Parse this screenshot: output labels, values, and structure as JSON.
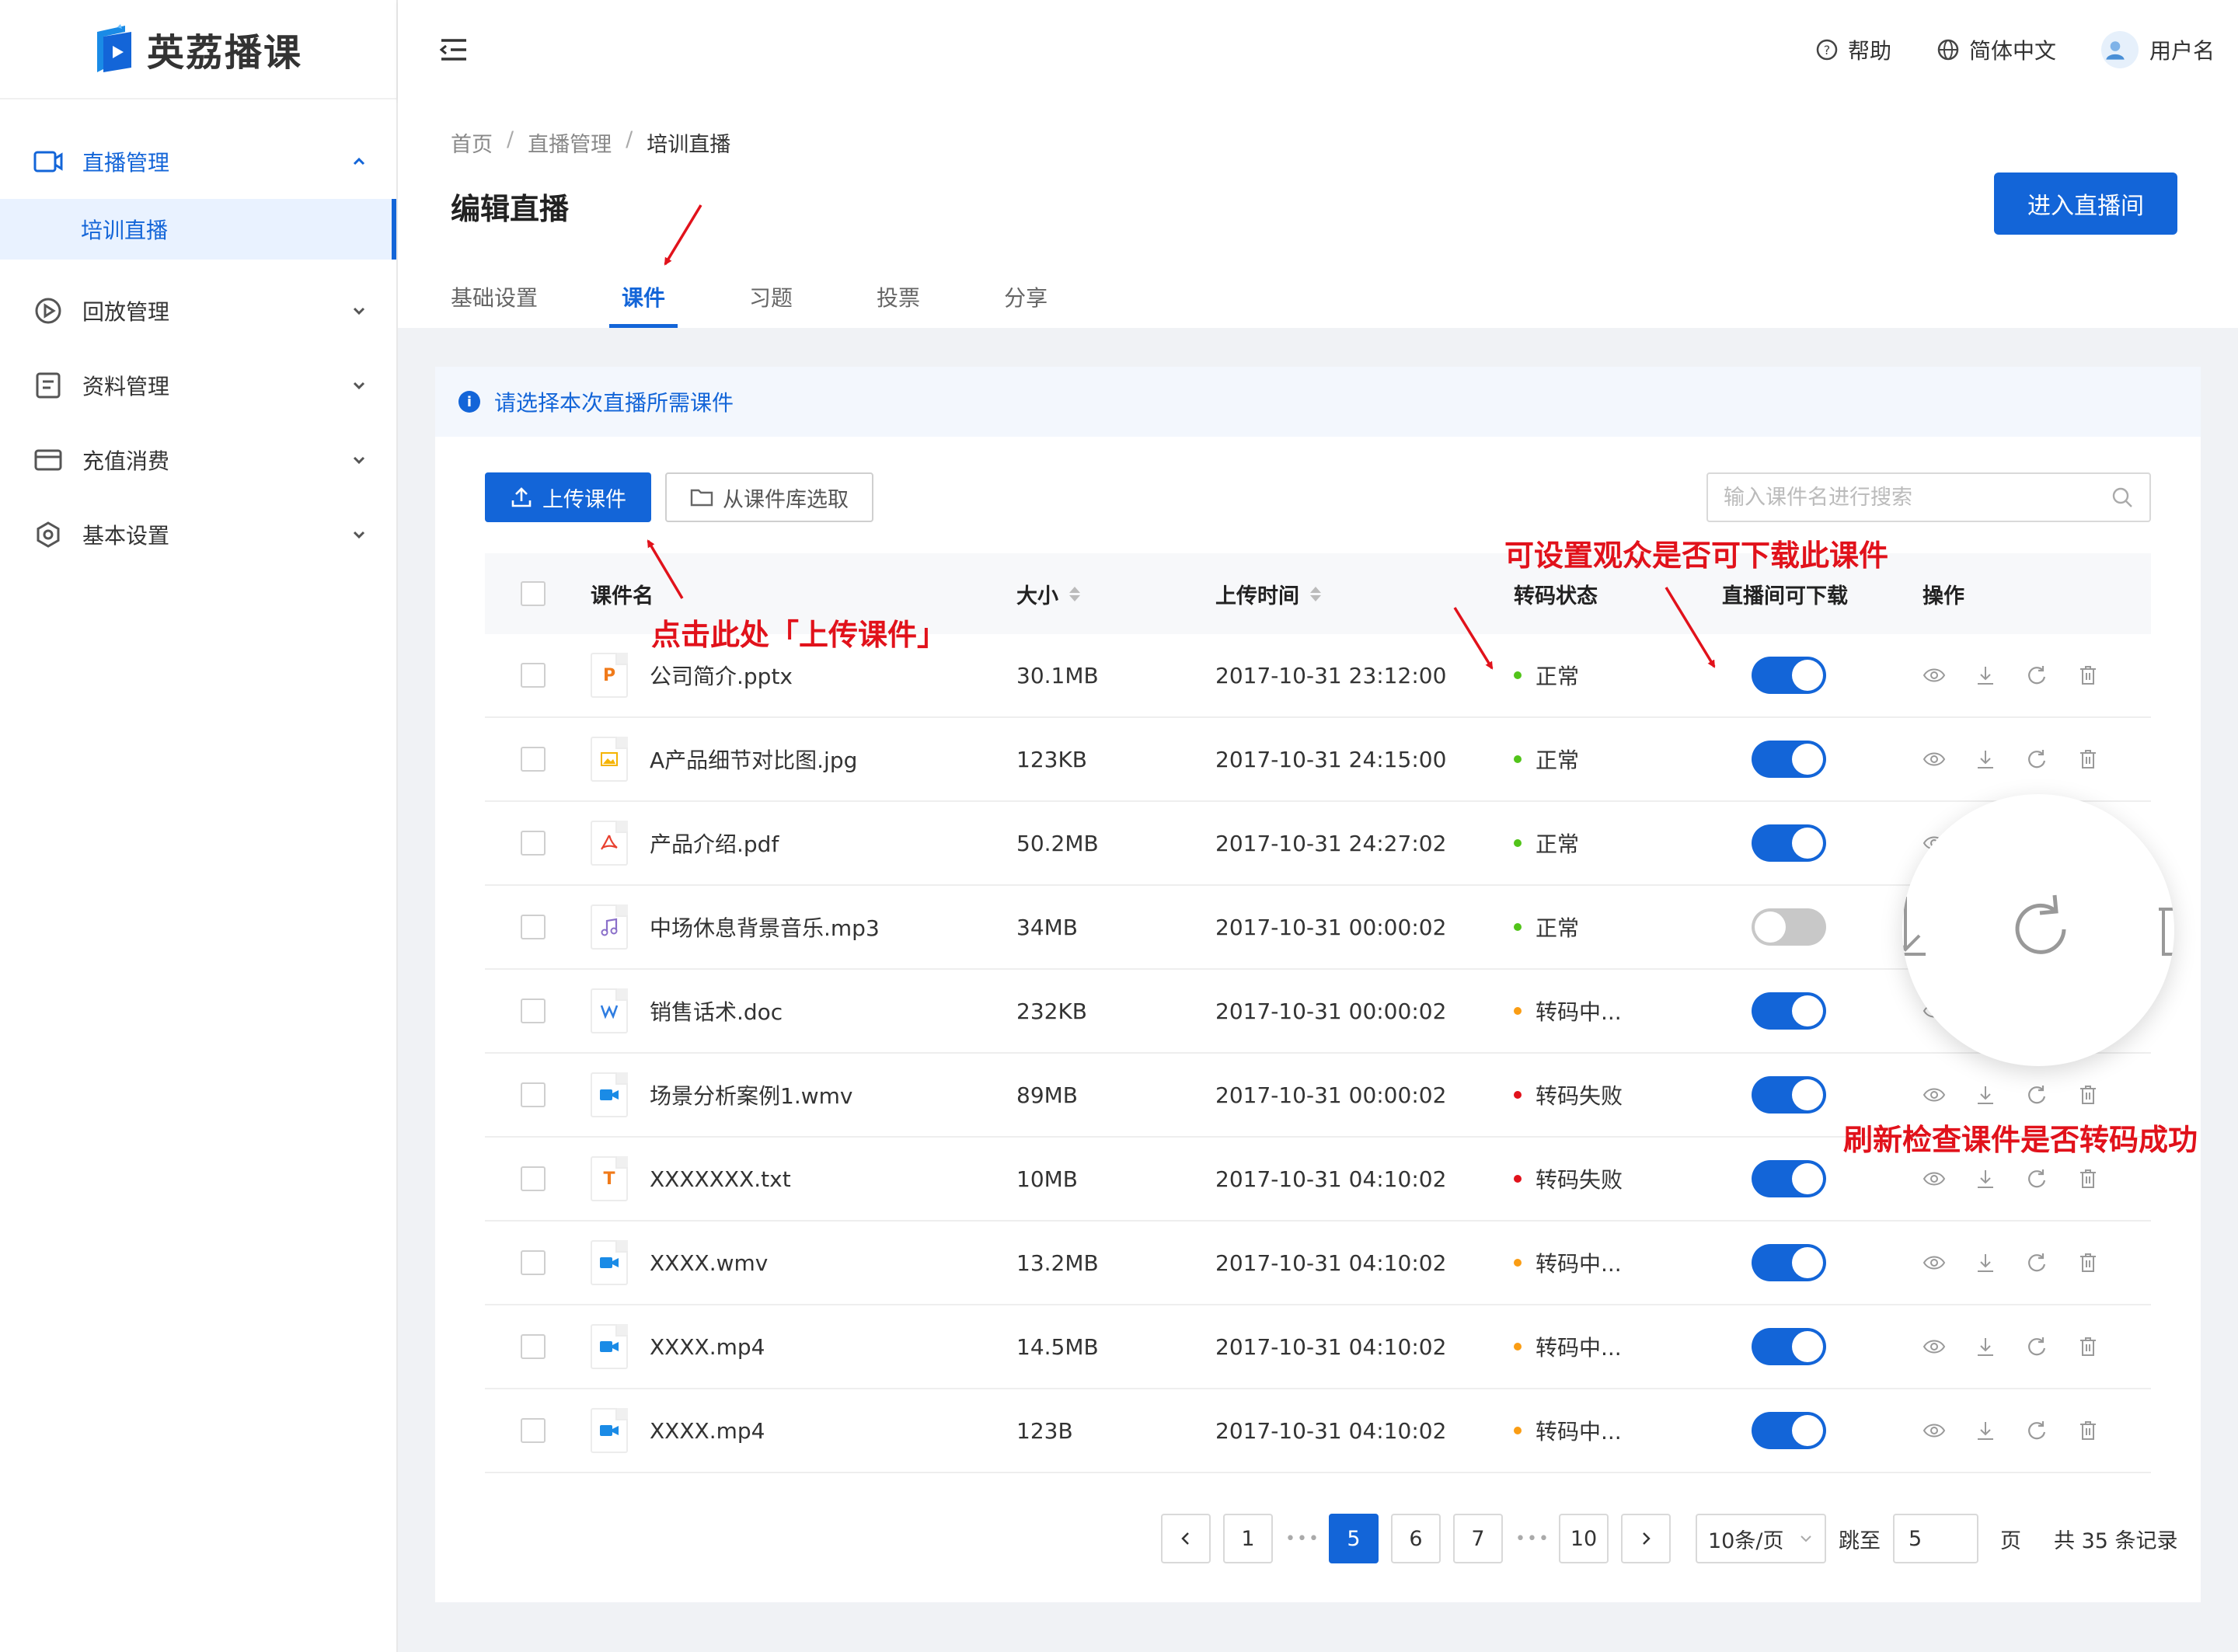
{
  "app": {
    "name": "英荔播课"
  },
  "sidebar": {
    "items": [
      {
        "label": "直播管理",
        "active": true,
        "expanded": true,
        "icon": "video-camera-icon"
      },
      {
        "label": "回放管理",
        "icon": "replay-icon"
      },
      {
        "label": "资料管理",
        "icon": "document-icon"
      },
      {
        "label": "充值消费",
        "icon": "wallet-icon"
      },
      {
        "label": "基本设置",
        "icon": "settings-icon"
      }
    ],
    "sub_active": "培训直播"
  },
  "header": {
    "help": "帮助",
    "language": "简体中文",
    "user": "用户名"
  },
  "breadcrumb": [
    "首页",
    "直播管理",
    "培训直播"
  ],
  "page": {
    "title": "编辑直播",
    "enter_button": "进入直播间"
  },
  "tabs": [
    "基础设置",
    "课件",
    "习题",
    "投票",
    "分享"
  ],
  "active_tab": "课件",
  "notice": "请选择本次直播所需课件",
  "toolbar": {
    "upload": "上传课件",
    "library": "从课件库选取",
    "search_placeholder": "输入课件名进行搜索"
  },
  "table": {
    "headers": {
      "name": "课件名",
      "size": "大小",
      "time": "上传时间",
      "status": "转码状态",
      "download": "直播间可下载",
      "ops": "操作"
    },
    "rows": [
      {
        "name": "公司简介.pptx",
        "type": "P",
        "color": "#f07a1a",
        "size": "30.1MB",
        "time": "2017-10-31  23:12:00",
        "status": "正常",
        "status_color": "#52c41a",
        "download": true
      },
      {
        "name": "A产品细节对比图.jpg",
        "type": "img",
        "color": "#f5b400",
        "size": "123KB",
        "time": "2017-10-31  24:15:00",
        "status": "正常",
        "status_color": "#52c41a",
        "download": true
      },
      {
        "name": "产品介绍.pdf",
        "type": "pdf",
        "color": "#e8402f",
        "size": "50.2MB",
        "time": "2017-10-31  24:27:02",
        "status": "正常",
        "status_color": "#52c41a",
        "download": true
      },
      {
        "name": "中场休息背景音乐.mp3",
        "type": "music",
        "color": "#8a6fc9",
        "size": "34MB",
        "time": "2017-10-31  00:00:02",
        "status": "正常",
        "status_color": "#52c41a",
        "download": false
      },
      {
        "name": "销售话术.doc",
        "type": "W",
        "color": "#2f7de1",
        "size": "232KB",
        "time": "2017-10-31  00:00:02",
        "status": "转码中...",
        "status_color": "#fa9d14",
        "download": true
      },
      {
        "name": "场景分析案例1.wmv",
        "type": "video",
        "color": "#1a8be6",
        "size": "89MB",
        "time": "2017-10-31  00:00:02",
        "status": "转码失败",
        "status_color": "#e1121b",
        "download": true
      },
      {
        "name": "XXXXXXX.txt",
        "type": "T",
        "color": "#f07a1a",
        "size": "10MB",
        "time": "2017-10-31  04:10:02",
        "status": "转码失败",
        "status_color": "#e1121b",
        "download": true
      },
      {
        "name": "XXXX.wmv",
        "type": "video",
        "color": "#1a8be6",
        "size": "13.2MB",
        "time": "2017-10-31  04:10:02",
        "status": "转码中...",
        "status_color": "#fa9d14",
        "download": true
      },
      {
        "name": "XXXX.mp4",
        "type": "video",
        "color": "#1a8be6",
        "size": "14.5MB",
        "time": "2017-10-31  04:10:02",
        "status": "转码中...",
        "status_color": "#fa9d14",
        "download": true
      },
      {
        "name": "XXXX.mp4",
        "type": "video",
        "color": "#1a8be6",
        "size": "123B",
        "time": "2017-10-31  04:10:02",
        "status": "转码中...",
        "status_color": "#fa9d14",
        "download": true
      }
    ]
  },
  "pagination": {
    "pages": [
      "1",
      "5",
      "6",
      "7",
      "10"
    ],
    "current": "5",
    "page_size": "10条/页",
    "jump_label": "跳至",
    "jump_value": "5",
    "page_unit": "页",
    "total": "共 35 条记录"
  },
  "annotations": {
    "upload": "点击此处「上传课件」",
    "download": "可设置观众是否可下载此课件",
    "refresh": "刷新检查课件是否转码成功"
  },
  "colors": {
    "primary": "#1365d8",
    "annotation": "#e1121b"
  }
}
